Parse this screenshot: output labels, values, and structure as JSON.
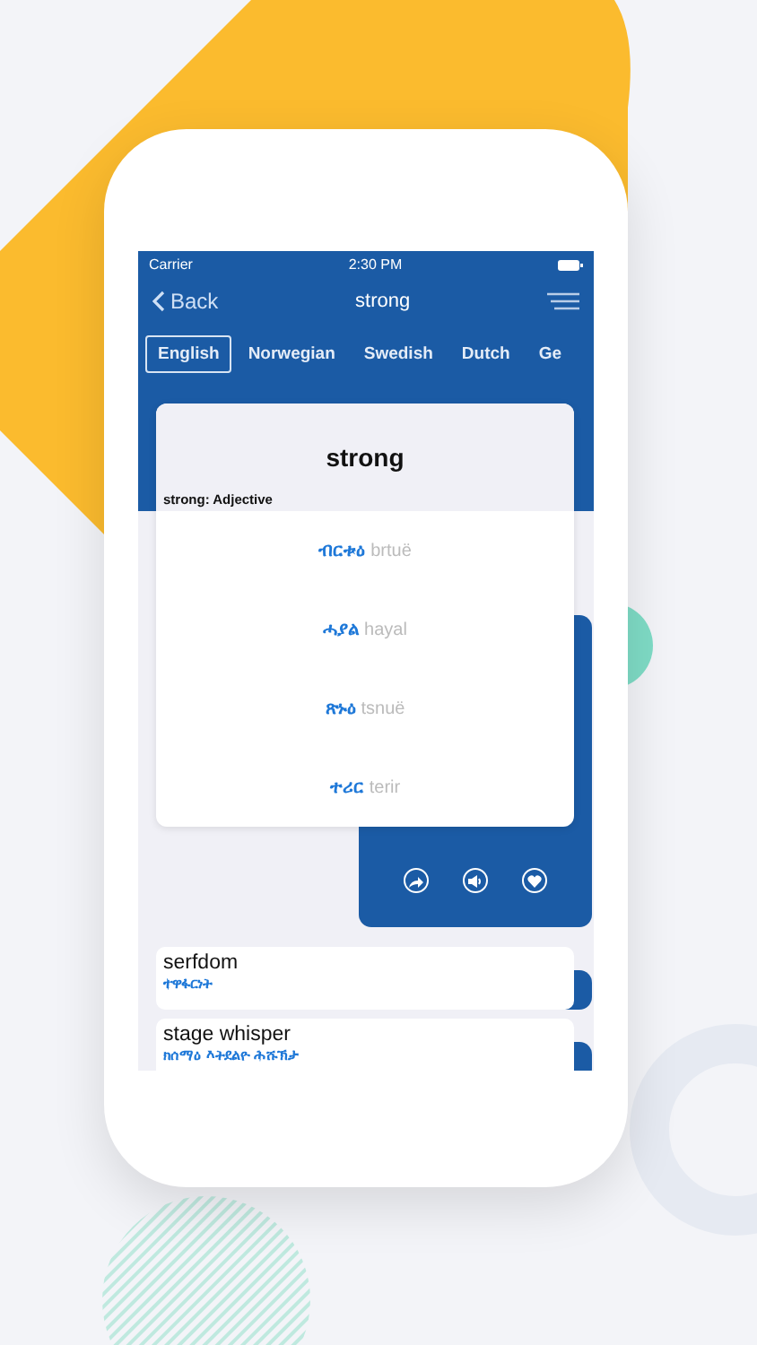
{
  "status_bar": {
    "carrier": "Carrier",
    "time": "2:30 PM"
  },
  "nav": {
    "back": "Back",
    "title": "strong"
  },
  "language_tabs": [
    {
      "label": "English",
      "selected": true
    },
    {
      "label": "Norwegian",
      "selected": false
    },
    {
      "label": "Swedish",
      "selected": false
    },
    {
      "label": "Dutch",
      "selected": false
    },
    {
      "label": "Ge",
      "selected": false
    }
  ],
  "word_card": {
    "word": "strong",
    "part_of_speech": "strong: Adjective",
    "translations": [
      {
        "word": "ብርቱዕ",
        "transliteration": "brtuë"
      },
      {
        "word": "ሓያል",
        "transliteration": "hayal"
      },
      {
        "word": "ጽኑዕ",
        "transliteration": "tsnuë"
      },
      {
        "word": "ተሪር",
        "transliteration": "terir"
      }
    ]
  },
  "results": [
    {
      "word": "serfdom",
      "translation": "ተዋፋርነት"
    },
    {
      "word": "stage whisper",
      "translation": "ክሰማዕ እትደልዮ ሕሹኽታ"
    }
  ]
}
